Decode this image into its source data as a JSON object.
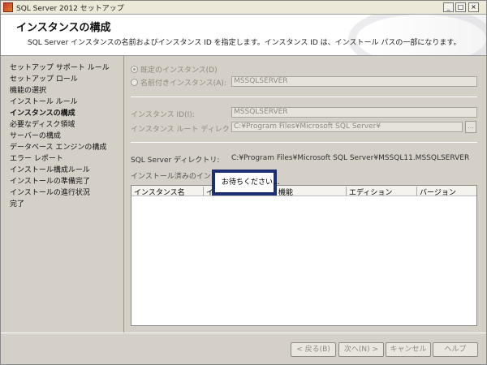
{
  "window": {
    "title": "SQL Server 2012 セットアップ",
    "min_glyph": "_",
    "max_glyph": "□",
    "close_glyph": "×"
  },
  "header": {
    "heading": "インスタンスの構成",
    "description": "SQL Server インスタンスの名前およびインスタンス ID を指定します。インスタンス ID は、インストール パスの一部になります。"
  },
  "nav": {
    "items": [
      {
        "label": "セットアップ サポート ルール"
      },
      {
        "label": "セットアップ ロール"
      },
      {
        "label": "機能の選択"
      },
      {
        "label": "インストール ルール"
      },
      {
        "label": "インスタンスの構成",
        "active": true
      },
      {
        "label": "必要なディスク領域"
      },
      {
        "label": "サーバーの構成"
      },
      {
        "label": "データベース エンジンの構成"
      },
      {
        "label": "エラー レポート"
      },
      {
        "label": "インストール構成ルール"
      },
      {
        "label": "インストールの準備完了"
      },
      {
        "label": "インストールの進行状況"
      },
      {
        "label": "完了"
      }
    ]
  },
  "form": {
    "default_instance_label": "既定のインスタンス(D)",
    "named_instance_label": "名前付きインスタンス(A):",
    "named_instance_value": "MSSQLSERVER",
    "instance_id_label": "インスタンス ID(I):",
    "instance_id_value": "MSSQLSERVER",
    "root_dir_label": "インスタンス ルート ディレクトリ(R):",
    "root_dir_value": "C:¥Program Files¥Microsoft SQL Server¥",
    "browse_label": "...",
    "sql_dir_label": "SQL Server ディレクトリ:",
    "sql_dir_value": "C:¥Program Files¥Microsoft SQL Server¥MSSQL11.MSSQLSERVER",
    "installed_label": "インストール済みのインスタン"
  },
  "table": {
    "columns": [
      "インスタンス名",
      "イ",
      "機能",
      "エディション",
      "バージョン"
    ],
    "rows": []
  },
  "wait_dialog": {
    "text": "お待ちください..."
  },
  "buttons": {
    "back": "< 戻る(B)",
    "next": "次へ(N) >",
    "cancel": "キャンセル",
    "help": "ヘルプ"
  }
}
